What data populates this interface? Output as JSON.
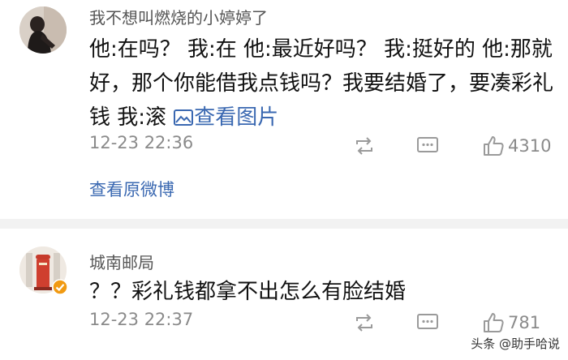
{
  "comments": [
    {
      "username": "我不想叫燃烧的小婷婷了",
      "text": "他:在吗？ 我:在 他:最近好吗？ 我:挺好的 他:那就好，那个你能借我点钱吗？我要结婚了，要凑彩礼钱 我:滚",
      "image_link": "查看图片",
      "time": "12-23 22:36",
      "likes": "4310",
      "view_original": "查看原微博"
    },
    {
      "username": "城南邮局",
      "text": "？？彩礼钱都拿不出怎么有脸结婚",
      "time": "12-23 22:37",
      "likes": "781"
    }
  ],
  "watermark": "头条 @助手哈说",
  "icons": {
    "repost": "repost-icon",
    "reply": "comment-icon",
    "like": "thumbs-up-icon",
    "image": "image-icon",
    "verified": "verified-badge-icon"
  },
  "colors": {
    "link": "#3a68b1",
    "meta": "#8a8a8a",
    "separator": "#f2f2f2",
    "verified": "#f19a12"
  }
}
